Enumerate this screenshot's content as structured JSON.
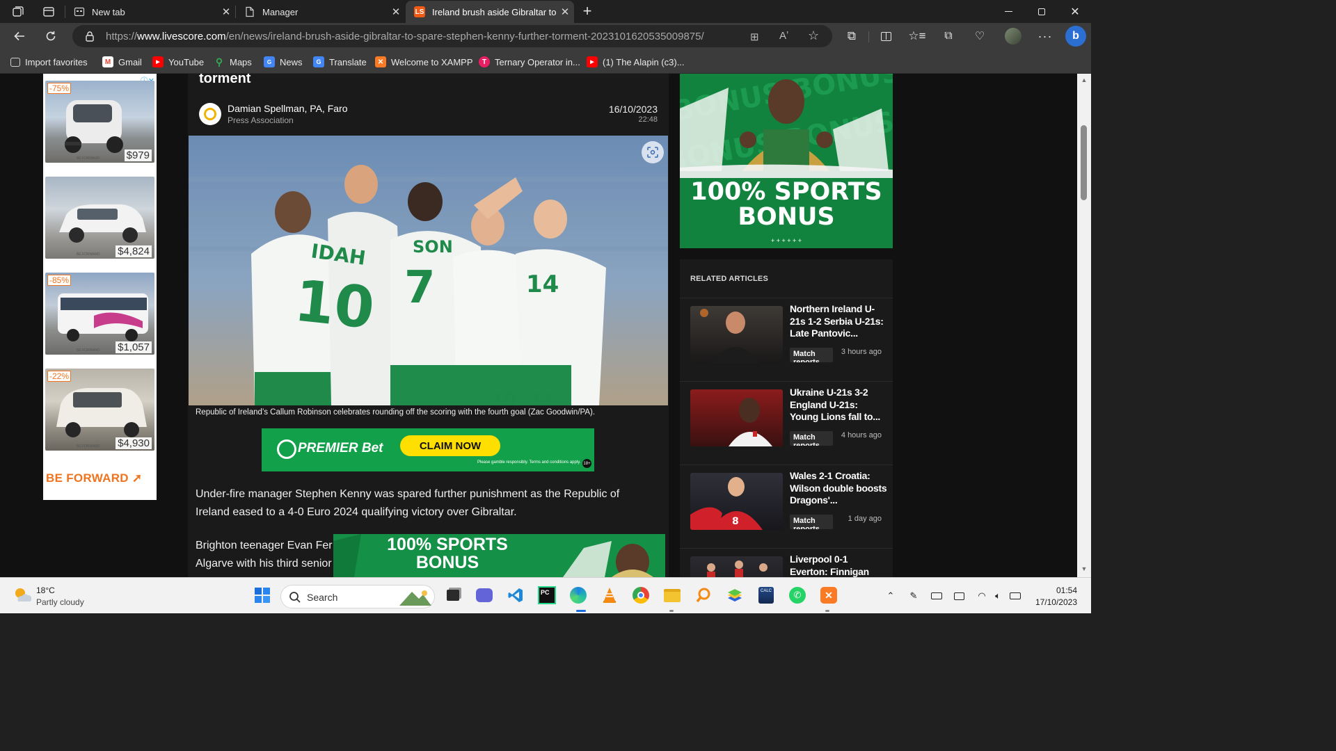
{
  "browser": {
    "tabs": [
      {
        "title": "New tab",
        "icon": "newtab-icon",
        "active": false
      },
      {
        "title": "Manager",
        "icon": "page-icon",
        "active": false
      },
      {
        "title": "Ireland brush aside Gibraltar to s",
        "icon": "livescore-icon",
        "active": true
      }
    ],
    "new_tab_glyph": "+",
    "url_prefix": "https://",
    "url_domain": "www.livescore.com",
    "url_path": "/en/news/ireland-brush-aside-gibraltar-to-spare-stephen-kenny-further-torment-20231016205350098​75/"
  },
  "bookmarks": [
    {
      "label": "Import favorites",
      "icon": "import-icon",
      "color": "#cccccc"
    },
    {
      "label": "Gmail",
      "icon": "gmail-icon",
      "color": "#ea4335"
    },
    {
      "label": "YouTube",
      "icon": "youtube-icon",
      "color": "#ff0000"
    },
    {
      "label": "Maps",
      "icon": "maps-icon",
      "color": "#34a853"
    },
    {
      "label": "News",
      "icon": "news-icon",
      "color": "#4285f4"
    },
    {
      "label": "Translate",
      "icon": "translate-icon",
      "color": "#4285f4"
    },
    {
      "label": "Welcome to XAMPP",
      "icon": "xampp-icon",
      "color": "#fb7a24"
    },
    {
      "label": "Ternary Operator in...",
      "icon": "ternary-icon",
      "color": "#e91e63"
    },
    {
      "label": "(1) The Alapin (c3)...",
      "icon": "youtube-icon",
      "color": "#ff0000"
    }
  ],
  "left_ad": {
    "adchoices": "ⓘ✕",
    "cars": [
      {
        "discount": "-75%",
        "price": "$979"
      },
      {
        "discount": "",
        "price": "$4,824"
      },
      {
        "discount": "-85%",
        "price": "$1,057"
      },
      {
        "discount": "-22%",
        "price": "$4,930"
      }
    ],
    "watermark": "BE FORWARD",
    "brand": "BE FORWARD"
  },
  "article": {
    "heading_fragment": "torment",
    "author": "Damian Spellman, PA, Faro",
    "organisation": "Press Association",
    "date": "16/10/2023",
    "time": "22:48",
    "hero_jersey_numbers": [
      "IDAH",
      "10",
      "SON",
      "7",
      "14",
      "10",
      "14"
    ],
    "caption": "Republic of Ireland’s Callum Robinson celebrates rounding off the scoring with the fourth goal (Zac Goodwin/PA).",
    "ad": {
      "brand": "PREMIER Bet",
      "cta": "CLAIM NOW",
      "fine_print": "Please gamble responsibly. Terms and conditions apply.",
      "age": "18+"
    },
    "paragraphs": [
      "Under-fire manager Stephen Kenny was spared further punishment as the Republic of Ireland eased to a 4-0 Euro 2024 qualifying victory over Gibraltar.",
      "Brighton teenager Evan Fer",
      "Algarve with his third senior"
    ],
    "bottom_banner_line1": "100% SPORTS",
    "bottom_banner_line2": "BONUS"
  },
  "right": {
    "banner_line1": "100% SPORTS",
    "banner_line2": "BONUS",
    "banner_bg_text": "BONUS BONUS BONUS",
    "related_title": "RELATED ARTICLES",
    "articles": [
      {
        "title": "Northern Ireland U-21s 1-2 Serbia U-21s: Late Pantovic...",
        "tag": "Match reports",
        "time": "3 hours ago"
      },
      {
        "title": "Ukraine U-21s 3-2 England U-21s: Young Lions fall to...",
        "tag": "Match reports",
        "time": "4 hours ago"
      },
      {
        "title": "Wales 2-1 Croatia: Wilson double boosts Dragons'...",
        "tag": "Match reports",
        "time": "1 day ago"
      },
      {
        "title": "Liverpool 0-1 Everton: Finnigan",
        "tag": "",
        "time": ""
      }
    ]
  },
  "taskbar": {
    "weather_temp": "18°C",
    "weather_desc": "Partly cloudy",
    "search_label": "Search",
    "clock_time": "01:54",
    "clock_date": "17/10/2023",
    "apps": [
      "start-icon",
      "search-icon",
      "task-view-icon",
      "teams-icon",
      "vscode-icon",
      "pycharm-icon",
      "edge-icon",
      "vlc-icon",
      "chrome-icon",
      "file-explorer-icon",
      "search-app-icon",
      "bluestacks-icon",
      "calculator-icon",
      "whatsapp-icon",
      "xampp-icon"
    ]
  }
}
